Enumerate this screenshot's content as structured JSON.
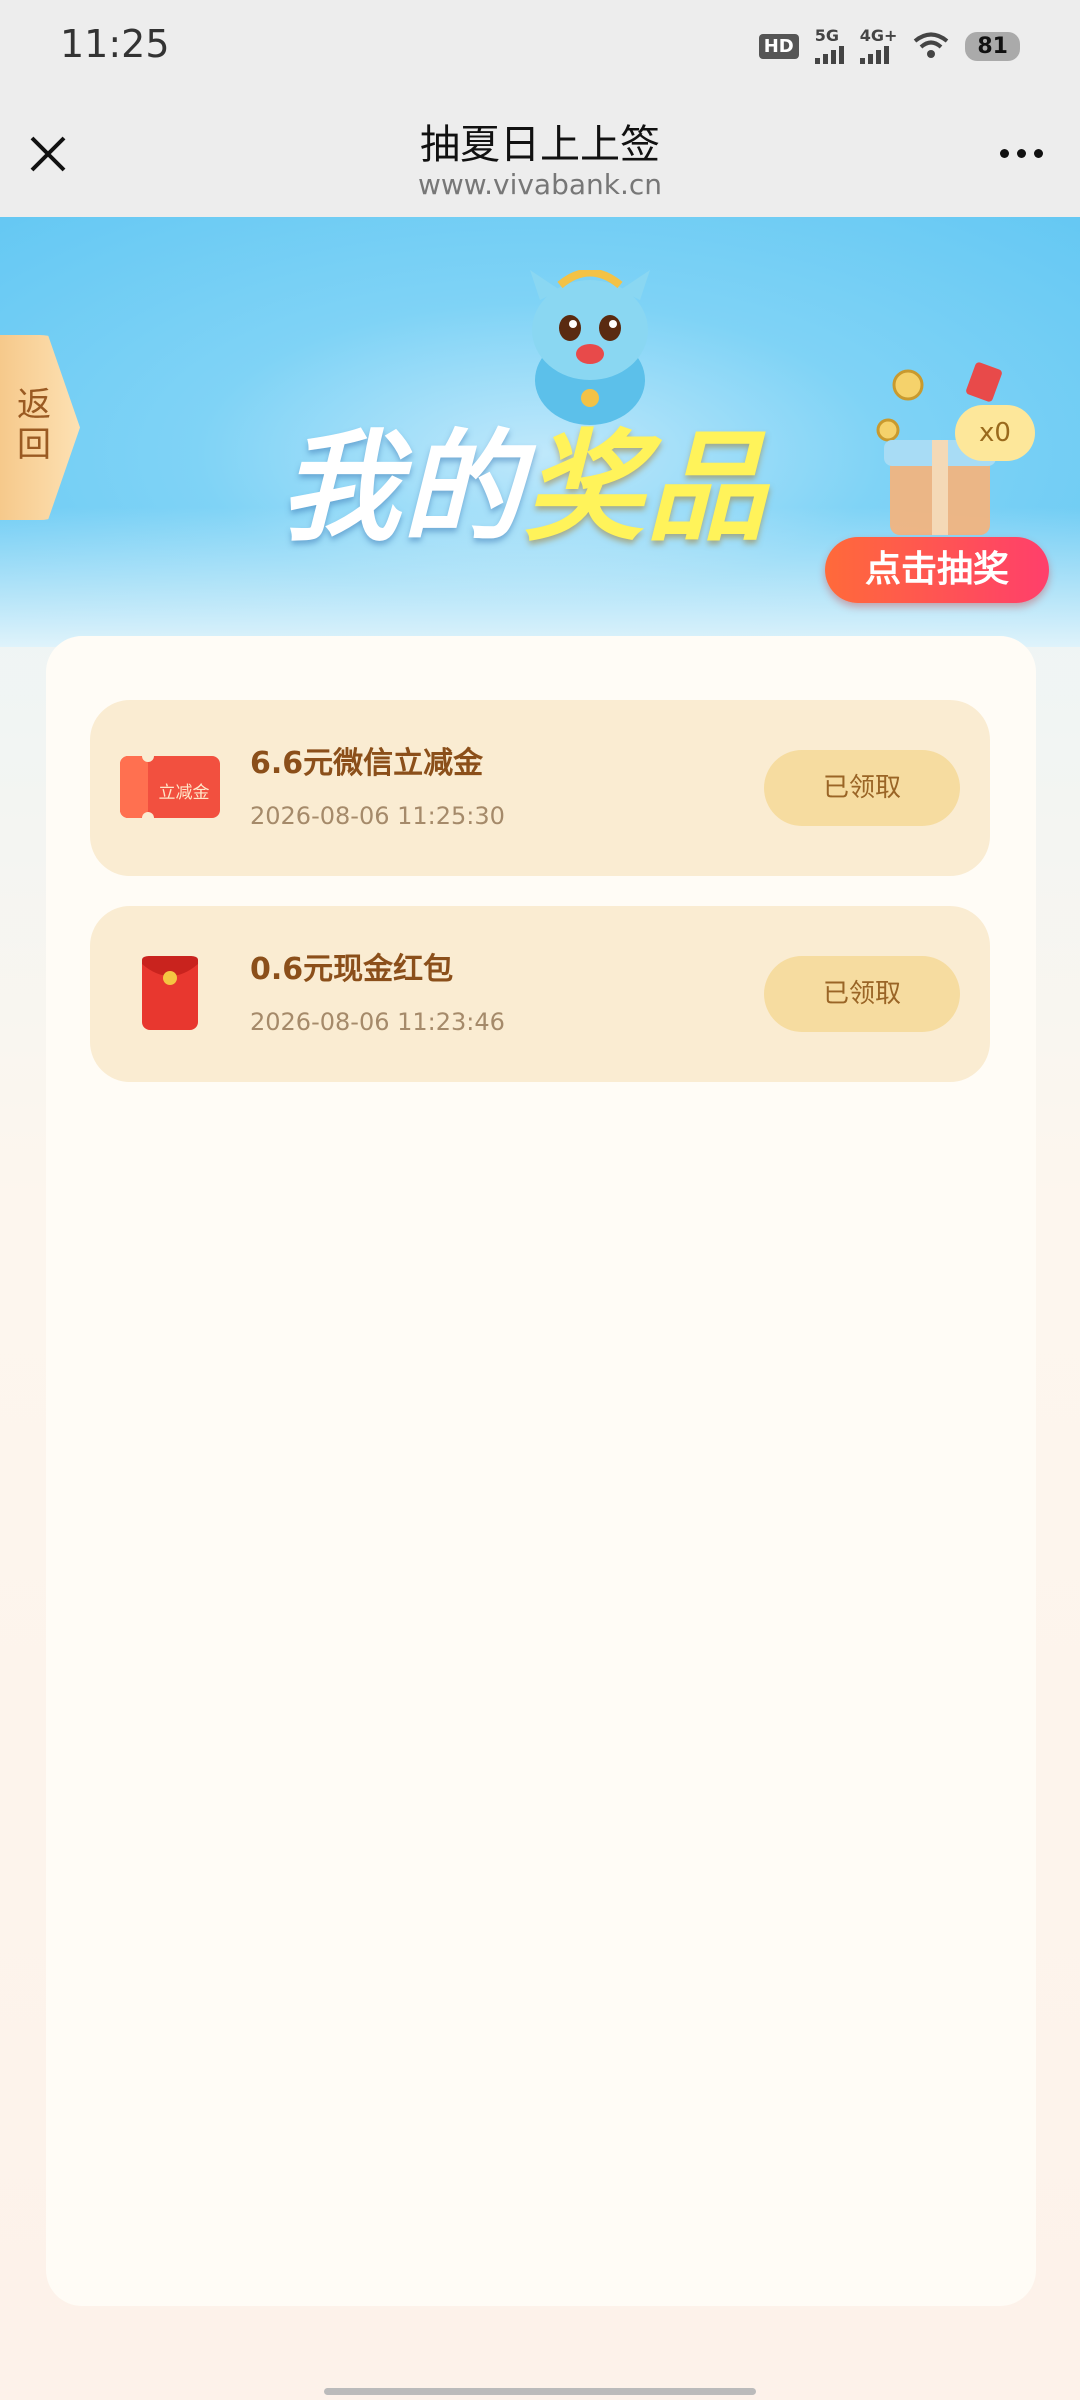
{
  "status_bar": {
    "time": "11:25",
    "hd_label": "HD",
    "network1": "5G",
    "network2": "4G+",
    "battery": "81"
  },
  "header": {
    "title": "抽夏日上上签",
    "url": "www.vivabank.cn"
  },
  "banner": {
    "back_label": "返回",
    "title_part1": "我的",
    "title_part2": "奖品",
    "gift_count": "x0",
    "draw_button": "点击抽奖"
  },
  "prizes": [
    {
      "name": "6.6元微信立减金",
      "time": "2026-08-06 11:25:30",
      "icon": "coupon-icon",
      "icon_label": "立减金",
      "button": "已领取"
    },
    {
      "name": "0.6元现金红包",
      "time": "2026-08-06 11:23:46",
      "icon": "red-envelope-icon",
      "button": "已领取"
    }
  ],
  "colors": {
    "accent": "#ff4f5a",
    "card_item": "#faecd2",
    "prize_text": "#8b4f1a"
  }
}
